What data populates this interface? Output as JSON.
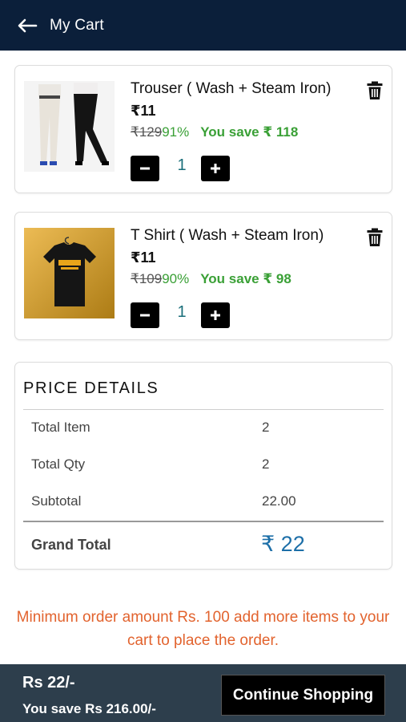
{
  "header": {
    "title": "My Cart",
    "background": "#0b1f3a"
  },
  "cart_items": [
    {
      "name": "Trouser ( Wash + Steam Iron)",
      "price": "₹11",
      "mrp": "₹129",
      "discount": "91%",
      "saving": "You save ₹ 118",
      "qty": "1",
      "image_icon": "trouser-product-image"
    },
    {
      "name": "T Shirt ( Wash + Steam Iron)",
      "price": "₹11",
      "mrp": "₹109",
      "discount": "90%",
      "saving": "You save ₹ 98",
      "qty": "1",
      "image_icon": "tshirt-product-image"
    }
  ],
  "price_details": {
    "title": "PRICE DETAILS",
    "rows": [
      {
        "label": "Total Item",
        "value": "2"
      },
      {
        "label": "Total Qty",
        "value": "2"
      },
      {
        "label": "Subtotal",
        "value": "22.00"
      }
    ],
    "grand_total_label": "Grand Total",
    "grand_total_value": "₹ 22"
  },
  "notice": {
    "min_order": "Minimum order amount Rs. 100 add more items to your cart to place the order.",
    "color": "#e2632e"
  },
  "footer": {
    "total": "Rs 22/-",
    "you_save": "You save Rs 216.00/-",
    "continue_label": "Continue Shopping"
  },
  "colors": {
    "accent_green": "#3aa036",
    "grand_total_blue": "#1d6fa8",
    "footer_bg": "#2d3e4c"
  }
}
